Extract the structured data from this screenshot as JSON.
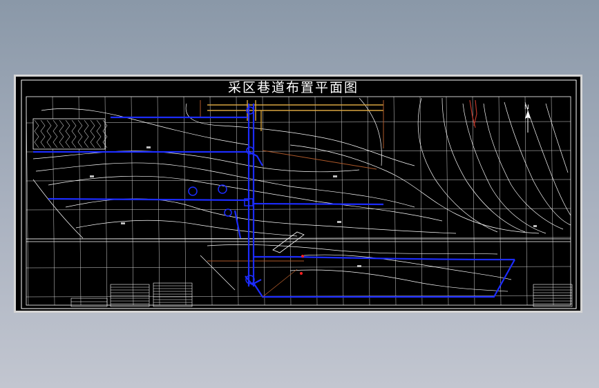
{
  "drawing": {
    "title": "采区巷道布置平面图",
    "north_label": "N"
  },
  "colors": {
    "background": "#000000",
    "grid": "#ffffff",
    "roadway": "#1c2cff",
    "contour": "#ffffff",
    "surface_road": "#d9a640",
    "fault": "#c0392b",
    "marker": "#ff2020"
  }
}
